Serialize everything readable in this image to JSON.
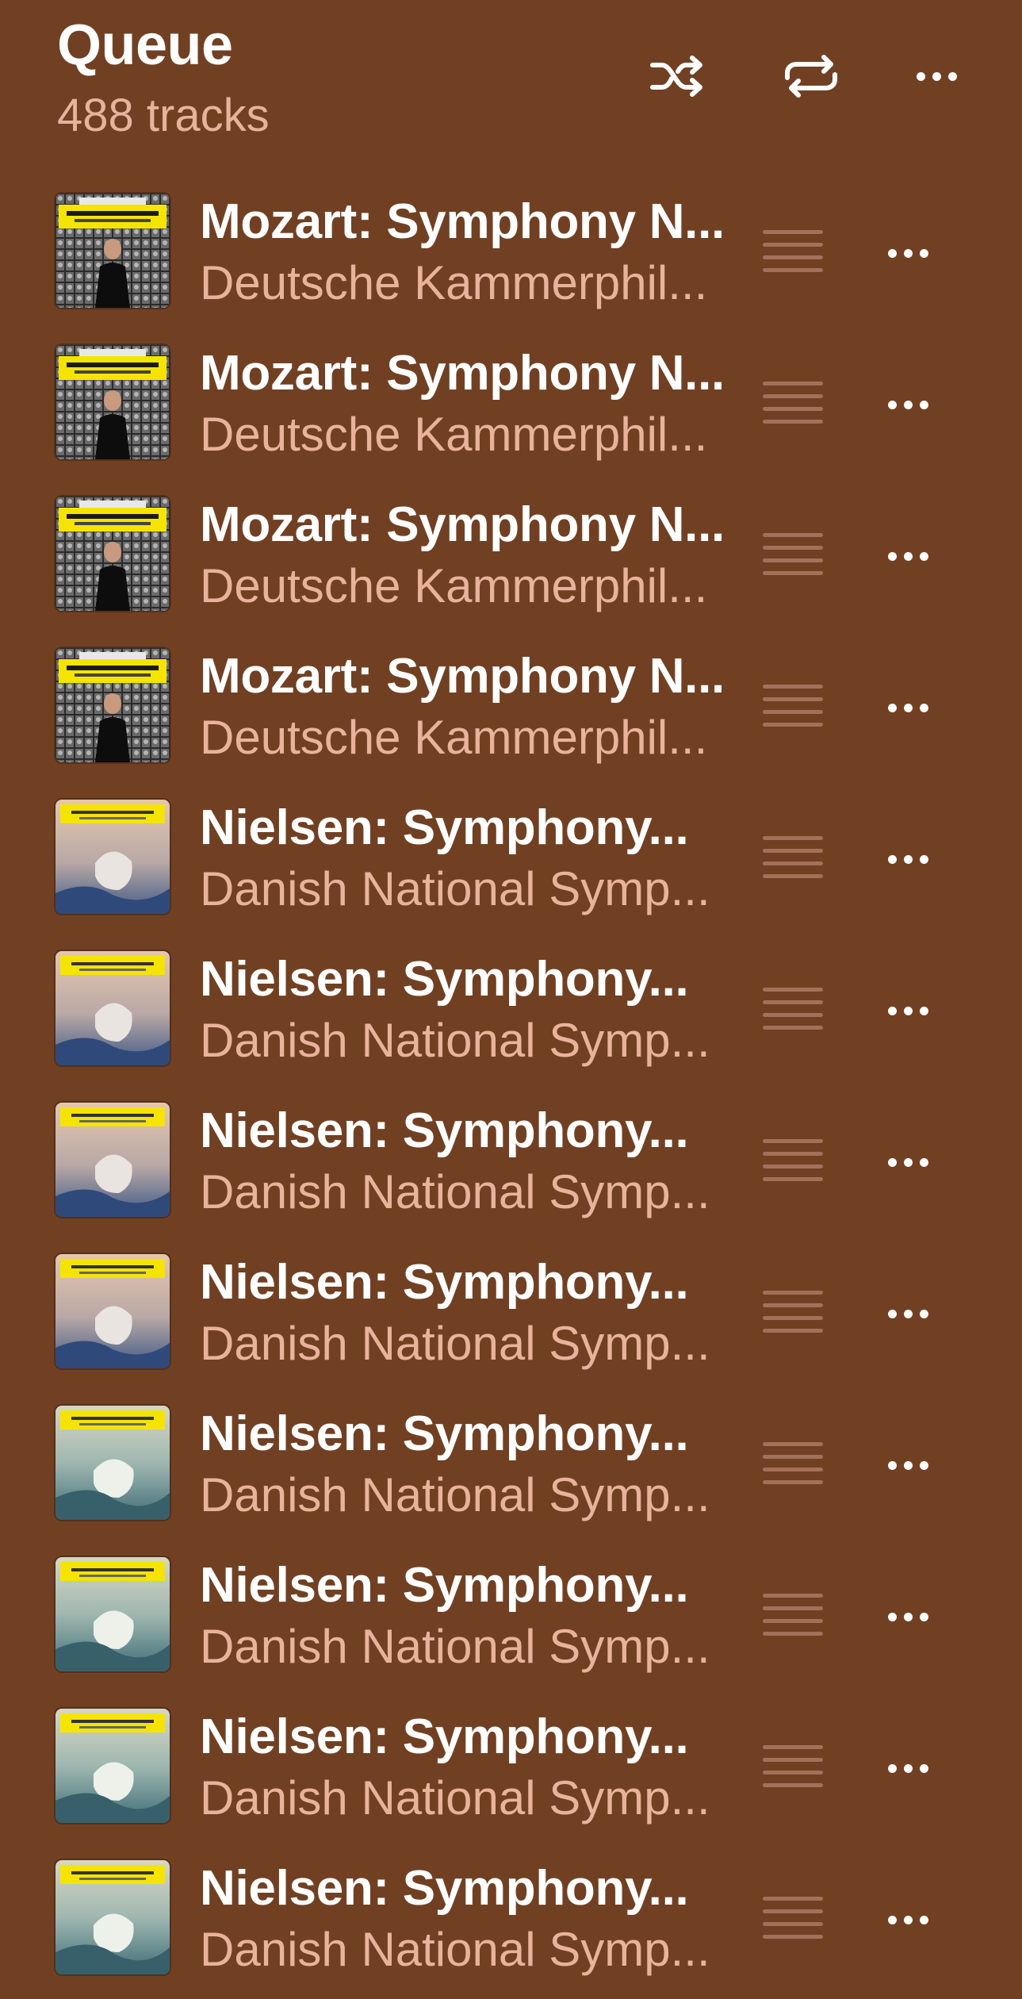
{
  "header": {
    "title": "Queue",
    "subtitle": "488 tracks",
    "shuffle_icon": "shuffle-icon",
    "repeat_icon": "repeat-icon",
    "more_icon": "more-horizontal-icon"
  },
  "colors": {
    "background": "#714023",
    "secondary_text": "#e8b39a",
    "drag_handle": "#a4705a"
  },
  "tracks": [
    {
      "title": "Mozart: Symphony N...",
      "artist": "Deutsche Kammerphil...",
      "album_art": "mozart-symphonies-cover"
    },
    {
      "title": "Mozart: Symphony N...",
      "artist": "Deutsche Kammerphil...",
      "album_art": "mozart-symphonies-cover"
    },
    {
      "title": "Mozart: Symphony N...",
      "artist": "Deutsche Kammerphil...",
      "album_art": "mozart-symphonies-cover"
    },
    {
      "title": "Mozart: Symphony N...",
      "artist": "Deutsche Kammerphil...",
      "album_art": "mozart-symphonies-cover"
    },
    {
      "title": "Nielsen: Symphony...",
      "artist": "Danish National Symp...",
      "album_art": "nielsen-symphonies-cover-a"
    },
    {
      "title": "Nielsen: Symphony...",
      "artist": "Danish National Symp...",
      "album_art": "nielsen-symphonies-cover-a"
    },
    {
      "title": "Nielsen: Symphony...",
      "artist": "Danish National Symp...",
      "album_art": "nielsen-symphonies-cover-a"
    },
    {
      "title": "Nielsen: Symphony...",
      "artist": "Danish National Symp...",
      "album_art": "nielsen-symphonies-cover-a"
    },
    {
      "title": "Nielsen: Symphony...",
      "artist": "Danish National Symp...",
      "album_art": "nielsen-symphonies-cover-b"
    },
    {
      "title": "Nielsen: Symphony...",
      "artist": "Danish National Symp...",
      "album_art": "nielsen-symphonies-cover-b"
    },
    {
      "title": "Nielsen: Symphony...",
      "artist": "Danish National Symp...",
      "album_art": "nielsen-symphonies-cover-b"
    },
    {
      "title": "Nielsen: Symphony...",
      "artist": "Danish National Symp...",
      "album_art": "nielsen-symphonies-cover-b"
    }
  ]
}
